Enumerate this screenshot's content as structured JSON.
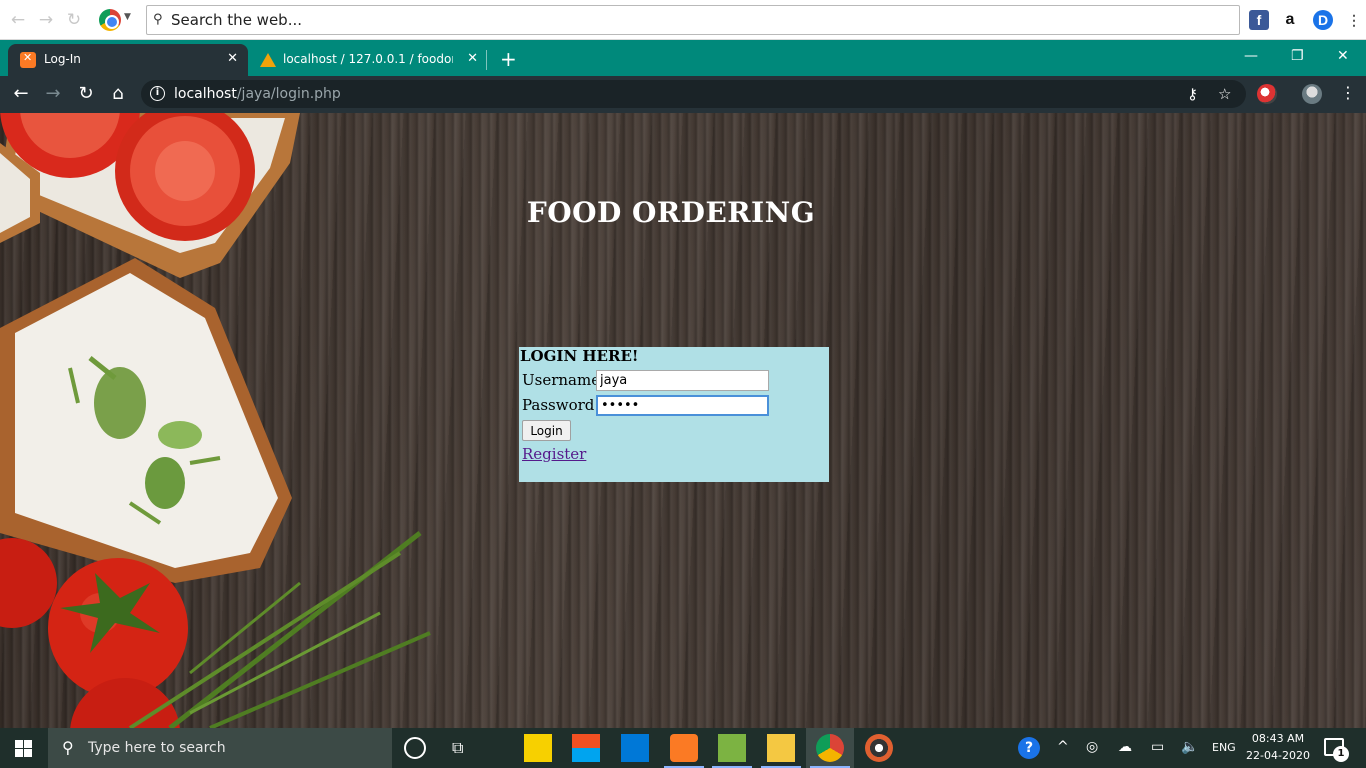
{
  "toolbar": {
    "search_placeholder": "Search the web...",
    "ext_fb": "f",
    "ext_amazon": "a",
    "ext_d": "D"
  },
  "tabs": [
    {
      "label": "Log-In",
      "icon": "xampp-icon",
      "active": true
    },
    {
      "label": "localhost / 127.0.0.1 / foodorder",
      "icon": "phpmyadmin-icon",
      "active": false
    }
  ],
  "address": {
    "host": "localhost",
    "path": "/jaya/login.php"
  },
  "page": {
    "title": "FOOD ORDERING",
    "login": {
      "heading": "LOGIN HERE!",
      "username_label": "Username:",
      "username_value": "jaya",
      "password_label": "Password:",
      "password_value": "•••••",
      "login_button": "Login",
      "register_link": "Register"
    },
    "colors": {
      "login_box_bg": "#b0e0e6",
      "title_color": "#ffffff"
    }
  },
  "taskbar": {
    "search_text": "Type here to search",
    "lang": "ENG",
    "time": "08:43 AM",
    "date": "22-04-2020",
    "notification_count": "1"
  }
}
